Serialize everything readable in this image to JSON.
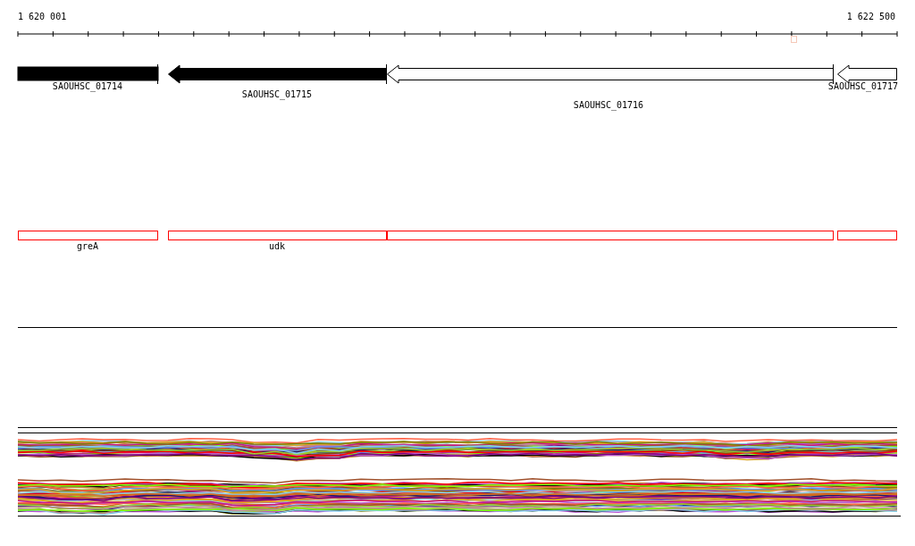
{
  "ruler": {
    "start_label": "1 620 001",
    "end_label": "1 622 500"
  },
  "genes": [
    {
      "label": "SAOUHSC_01714",
      "kind": "bar",
      "filled": true
    },
    {
      "label": "SAOUHSC_01715",
      "kind": "arrow",
      "filled": true
    },
    {
      "label": "SAOUHSC_01716",
      "kind": "arrow",
      "filled": false
    },
    {
      "label": "SAOUHSC_01717",
      "kind": "arrow",
      "filled": false
    }
  ],
  "features": [
    {
      "kind": "box",
      "label": "greA"
    },
    {
      "kind": "box",
      "label": "udk"
    },
    {
      "kind": "box"
    },
    {
      "kind": "box"
    }
  ]
}
